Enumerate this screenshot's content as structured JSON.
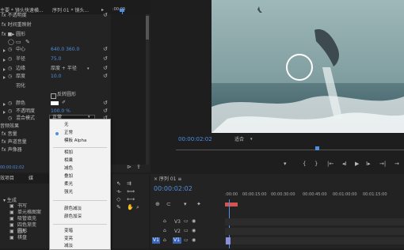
{
  "effect_controls": {
    "tab_master": "主要 * 镜头快速横...",
    "tab_sequence": "序列 01 * 镜头...",
    "timecode_ruler": ":00:00",
    "rows": [
      {
        "label": "fx 不透明度",
        "indent": 0
      },
      {
        "label": "fx 时间重映射",
        "indent": 0
      },
      {
        "label": "fx ■▸ 圆形",
        "indent": 0
      },
      {
        "label": "中心",
        "indent": 1,
        "value": "640.0    360.0"
      },
      {
        "label": "半径",
        "indent": 1,
        "value": "75.0"
      },
      {
        "label": "边缘",
        "indent": 1,
        "value": "厚度 + 半径"
      },
      {
        "label": "厚度",
        "indent": 1,
        "value": "10.0"
      },
      {
        "label": "羽化",
        "indent": 1,
        "value": ""
      },
      {
        "label": "",
        "indent": 1,
        "value": "反转圆形"
      },
      {
        "label": "颜色",
        "indent": 1,
        "value": ""
      },
      {
        "label": "不透明度",
        "indent": 1,
        "value": "100.0 %"
      },
      {
        "label": "混合模式",
        "indent": 1,
        "value": "正常"
      }
    ],
    "audio_header": "音频效果",
    "audio_rows": [
      "fx 音量",
      "fx 声道音量",
      "fx 声像器"
    ],
    "bottom_timecode": "00:00:02:02"
  },
  "blend_menu": {
    "items": [
      "无",
      "正常",
      "模板 Alpha",
      "相加",
      "相乘",
      "减色",
      "叠加",
      "柔光",
      "强光",
      "颜色减淡",
      "颜色加深",
      "变暗",
      "变亮",
      "减淡"
    ],
    "selected": "正常"
  },
  "program_monitor": {
    "timecode": "00:00:02:02",
    "fit_label": "适合"
  },
  "project_panel": {
    "tab_project": "效项目",
    "tab_media": "媒",
    "items": [
      "▾ 生成",
      "书写",
      "单元格图案",
      "吸管填充",
      "四色渐变",
      "圆形",
      "棋盘"
    ]
  },
  "timeline": {
    "tab": "× 序列 01 ≡",
    "timecode": "00:00:02:02",
    "ruler": [
      ":00:00",
      "00:00:15:00",
      "00:00:30:00",
      "00:00:45:00",
      "00:01:00:00",
      "00:01:15:00"
    ],
    "tracks": [
      "V3",
      "V2",
      "V1"
    ],
    "source_label": "V1"
  },
  "colors": {
    "accent": "#4d8fe0",
    "panel": "#232323",
    "background": "#1e1e1e",
    "menu_bg": "#f2f2f2"
  }
}
